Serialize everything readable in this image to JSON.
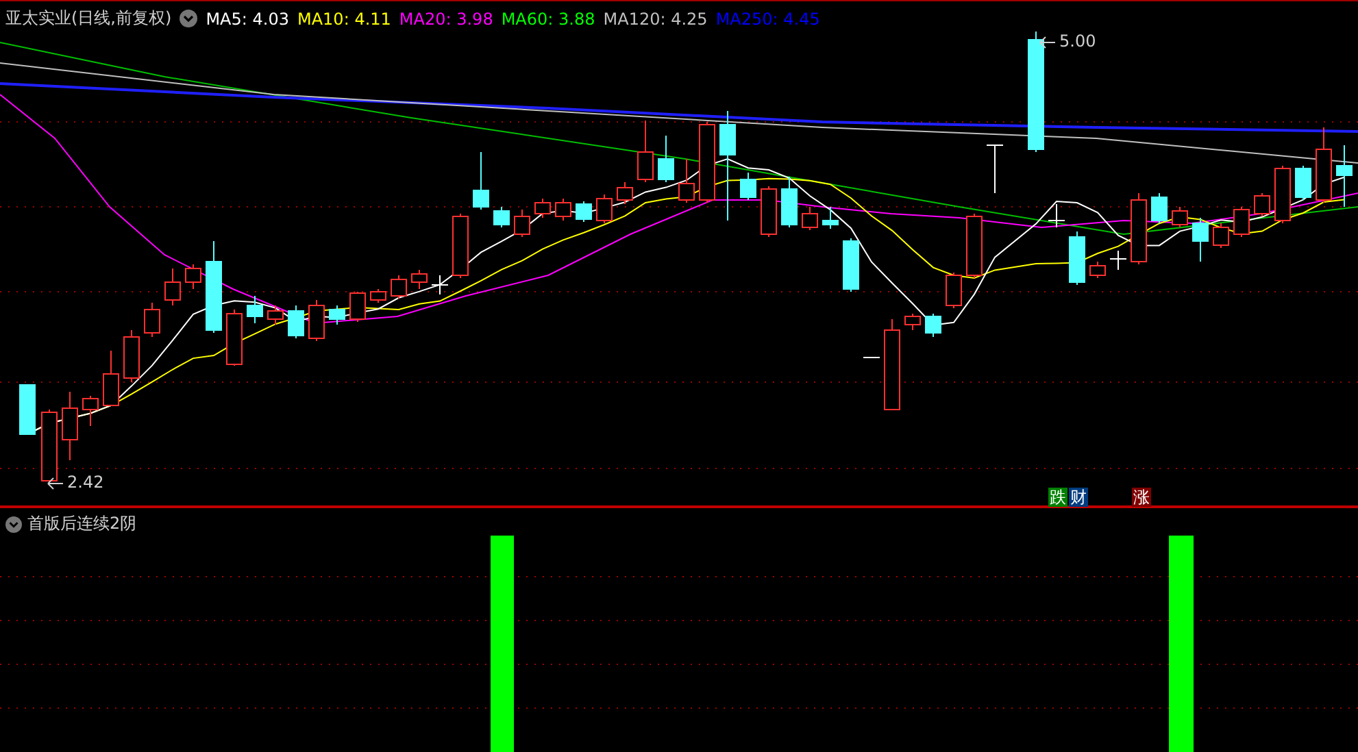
{
  "main_panel": {
    "title": "亚太实业(日线,前复权)",
    "legend": [
      {
        "label": "MA5:",
        "value": "4.03",
        "color": "#ffffff"
      },
      {
        "label": "MA10:",
        "value": "4.11",
        "color": "#ffff00"
      },
      {
        "label": "MA20:",
        "value": "3.98",
        "color": "#ff00ff"
      },
      {
        "label": "MA60:",
        "value": "3.88",
        "color": "#00ff00"
      },
      {
        "label": "MA120:",
        "value": "4.25",
        "color": "#c0c0c0"
      },
      {
        "label": "MA250:",
        "value": "4.45",
        "color": "#0000ff"
      }
    ],
    "high_mark": "5.00",
    "low_mark": "2.42",
    "signals": [
      {
        "text": "跌",
        "color": "#008000"
      },
      {
        "text": "财",
        "color": "#003c80"
      },
      {
        "text": "涨",
        "color": "#800000"
      }
    ]
  },
  "indicator_panel": {
    "title": "首版后连续2阴"
  }
}
